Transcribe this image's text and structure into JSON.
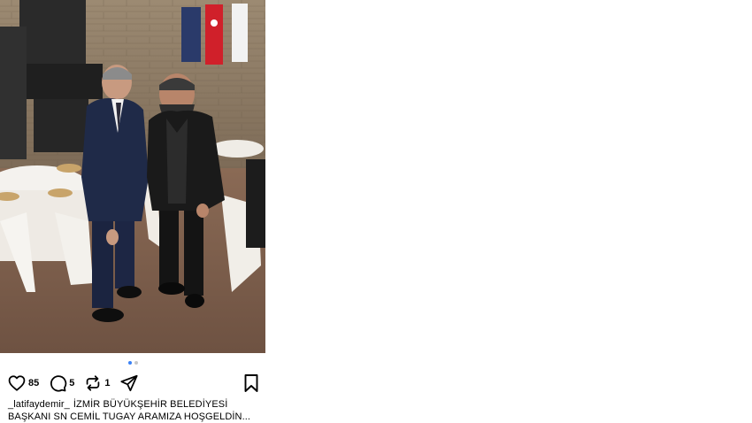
{
  "post": {
    "photo_alt": "",
    "carousel": {
      "total": 2,
      "active": 1
    },
    "actions": {
      "like": {
        "icon": "heart-icon",
        "count": "85"
      },
      "comment": {
        "icon": "comment-icon",
        "count": "5"
      },
      "repost": {
        "icon": "repost-icon",
        "count": "1"
      },
      "share": {
        "icon": "send-icon"
      },
      "save": {
        "icon": "bookmark-icon"
      }
    },
    "caption": {
      "username": "_latifaydemir_",
      "text": "İZMİR BÜYÜKŞEHİR BELEDİYESİ BAŞKANI SN CEMİL TUGAY ARAMIZA HOŞGELDİN..."
    }
  },
  "colors": {
    "background": "#ffffff",
    "text": "#000000",
    "carousel_active": "#3b82f6",
    "carousel_inactive": "#c7c7c7"
  }
}
